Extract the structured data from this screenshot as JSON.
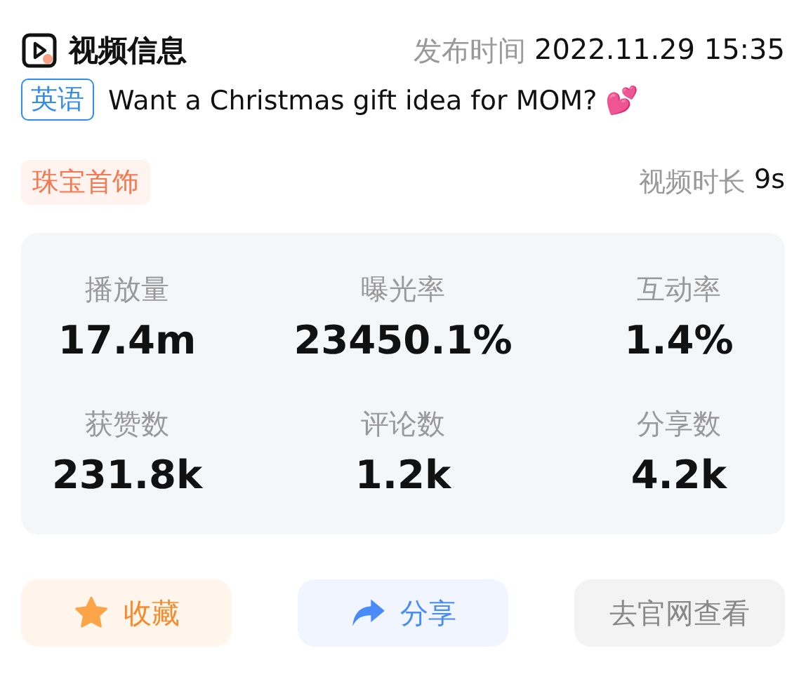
{
  "header": {
    "title": "视频信息",
    "publish_label": "发布时间",
    "publish_time": "2022.11.29 15:35"
  },
  "video": {
    "language_tag": "英语",
    "caption": "Want a Christmas gift idea for MOM? 💕"
  },
  "category_tag": "珠宝首饰",
  "duration": {
    "label": "视频时长",
    "value": "9s"
  },
  "stats": [
    {
      "label": "播放量",
      "value": "17.4m"
    },
    {
      "label": "曝光率",
      "value": "23450.1%"
    },
    {
      "label": "互动率",
      "value": "1.4%"
    },
    {
      "label": "获赞数",
      "value": "231.8k"
    },
    {
      "label": "评论数",
      "value": "1.2k"
    },
    {
      "label": "分享数",
      "value": "4.2k"
    }
  ],
  "buttons": [
    {
      "kind": "favorite",
      "label": "收藏"
    },
    {
      "kind": "share",
      "label": "分享"
    },
    {
      "kind": "website",
      "label": "去官网查看"
    }
  ]
}
